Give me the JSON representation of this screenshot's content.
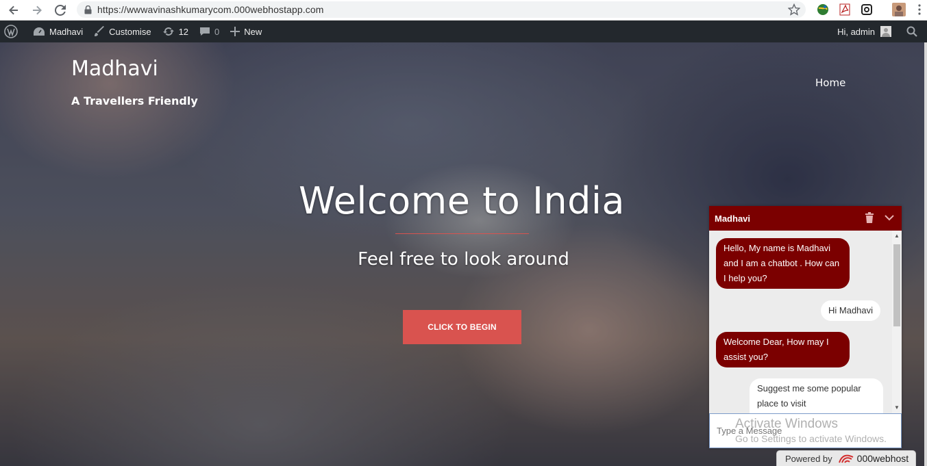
{
  "browser": {
    "url": "https://wwwavinashkumarycom.000webhostapp.com",
    "icons": [
      "back-icon",
      "forward-icon",
      "reload-icon",
      "lock-icon",
      "star-icon"
    ]
  },
  "adminbar": {
    "site_name": "Madhavi",
    "customise": "Customise",
    "updates_count": "12",
    "comments_count": "0",
    "new_label": "New",
    "greeting": "Hi, admin"
  },
  "site": {
    "title": "Madhavi",
    "description": "A Travellers Friendly",
    "nav_home": "Home"
  },
  "hero": {
    "title": "Welcome to India",
    "subtitle": "Feel free to look around",
    "cta": "CLICK TO BEGIN"
  },
  "chat": {
    "header_name": "Madhavi",
    "messages": [
      {
        "from": "bot",
        "text": "Hello, My name is Madhavi and I am a chatbot . How can I help you?"
      },
      {
        "from": "user",
        "text": "Hi Madhavi"
      },
      {
        "from": "bot",
        "text": "Welcome Dear, How may I assist you?"
      },
      {
        "from": "user",
        "text": "Suggest me some popular place to visit"
      }
    ],
    "input_placeholder": "Type a Message"
  },
  "watermark": {
    "line1": "Activate Windows",
    "line2": "Go to Settings to activate Windows."
  },
  "powered": {
    "label": "Powered by",
    "brand": "000webhost"
  },
  "colors": {
    "chat_primary": "#7b0000",
    "cta": "#d9534f",
    "adminbar": "#23282d"
  }
}
